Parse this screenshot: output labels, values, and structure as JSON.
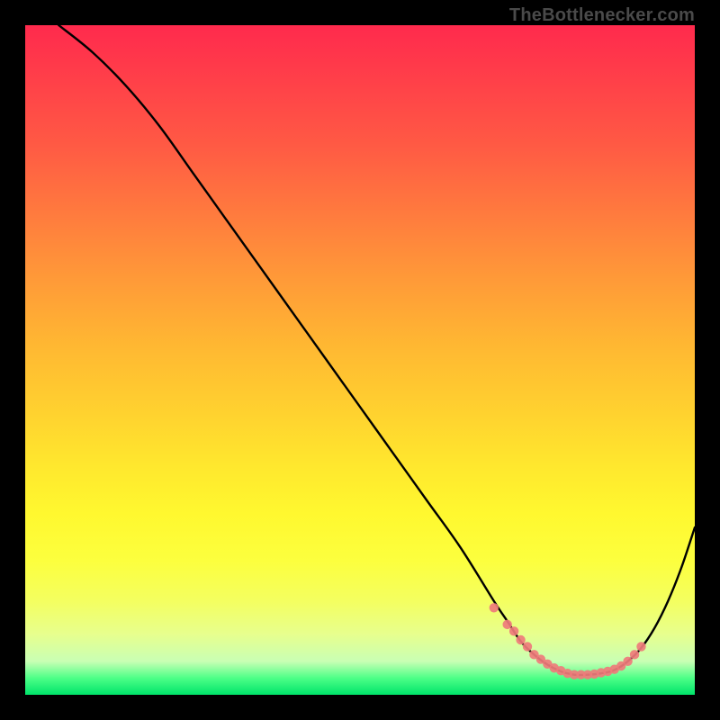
{
  "attribution": "TheBottlenecker.com",
  "chart_data": {
    "type": "line",
    "title": "",
    "xlabel": "",
    "ylabel": "",
    "xlim": [
      0,
      100
    ],
    "ylim": [
      0,
      100
    ],
    "grid": false,
    "series": [
      {
        "name": "bottleneck-curve",
        "color": "#000000",
        "x": [
          5,
          10,
          15,
          20,
          25,
          30,
          35,
          40,
          45,
          50,
          55,
          60,
          65,
          70,
          72,
          74,
          76,
          78,
          80,
          82,
          84,
          86,
          88,
          90,
          92,
          94,
          96,
          98,
          100
        ],
        "values": [
          100,
          96,
          91,
          85,
          78,
          71,
          64,
          57,
          50,
          43,
          36,
          29,
          22,
          14,
          11,
          8,
          6,
          4.5,
          3.5,
          3,
          3,
          3.2,
          3.7,
          5,
          7,
          10,
          14,
          19,
          25
        ]
      }
    ],
    "markers": {
      "name": "highlight-band",
      "color": "#ef7b7b",
      "x": [
        70,
        72,
        73,
        74,
        75,
        76,
        77,
        78,
        79,
        80,
        81,
        82,
        83,
        84,
        85,
        86,
        87,
        88,
        89,
        90,
        91,
        92
      ],
      "values": [
        13,
        10.5,
        9.5,
        8.2,
        7.2,
        6,
        5.3,
        4.6,
        4,
        3.6,
        3.2,
        3,
        3,
        3,
        3.1,
        3.3,
        3.5,
        3.8,
        4.3,
        5,
        6,
        7.2
      ]
    }
  }
}
